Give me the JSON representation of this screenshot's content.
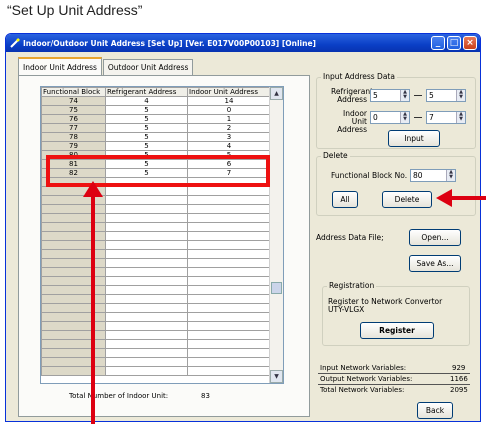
{
  "caption": "“Set Up Unit Address”",
  "window": {
    "title": "Indoor/Outdoor Unit Address  [Set Up] [Ver. E017V00P00103] [Online]"
  },
  "tabs": [
    "Indoor Unit Address",
    "Outdoor Unit Address"
  ],
  "table": {
    "headers": [
      "Functional Block",
      "Refrigerant Address",
      "Indoor Unit Address"
    ],
    "rows": [
      [
        "74",
        "4",
        "14"
      ],
      [
        "75",
        "5",
        "0"
      ],
      [
        "76",
        "5",
        "1"
      ],
      [
        "77",
        "5",
        "2"
      ],
      [
        "78",
        "5",
        "3"
      ],
      [
        "79",
        "5",
        "4"
      ],
      [
        "80",
        "5",
        "5"
      ],
      [
        "81",
        "5",
        "6"
      ],
      [
        "82",
        "5",
        "7"
      ]
    ]
  },
  "total": {
    "label": "Total Number of Indoor Unit:",
    "value": "83"
  },
  "input_address": {
    "title": "Input Address Data",
    "refrigerant_label_1": "Refrigerant",
    "refrigerant_label_2": "Address",
    "refrigerant_from": "5",
    "refrigerant_to": "5",
    "indoor_label_1": "Indoor Unit",
    "indoor_label_2": "Address",
    "indoor_from": "0",
    "indoor_to": "7",
    "input_button": "Input"
  },
  "delete_group": {
    "title": "Delete",
    "fb_label": "Functional Block No.",
    "fb_value": "80",
    "all_button": "All",
    "delete_button": "Delete"
  },
  "address_file": {
    "label": "Address Data File;",
    "open_button": "Open...",
    "saveas_button": "Save As..."
  },
  "registration": {
    "title": "Registration",
    "text_1": "Register to Network Convertor",
    "text_2": "UTY-VLGX",
    "register_button": "Register"
  },
  "network": {
    "input_label": "Input Network Variables:",
    "input_value": "929",
    "output_label": "Output Network Variables:",
    "output_value": "1166",
    "total_label": "Total Network Variables:",
    "total_value": "2095"
  },
  "back_button": "Back",
  "colors": {
    "highlight": "#e11111",
    "titlebar": "#0a3fc6"
  }
}
